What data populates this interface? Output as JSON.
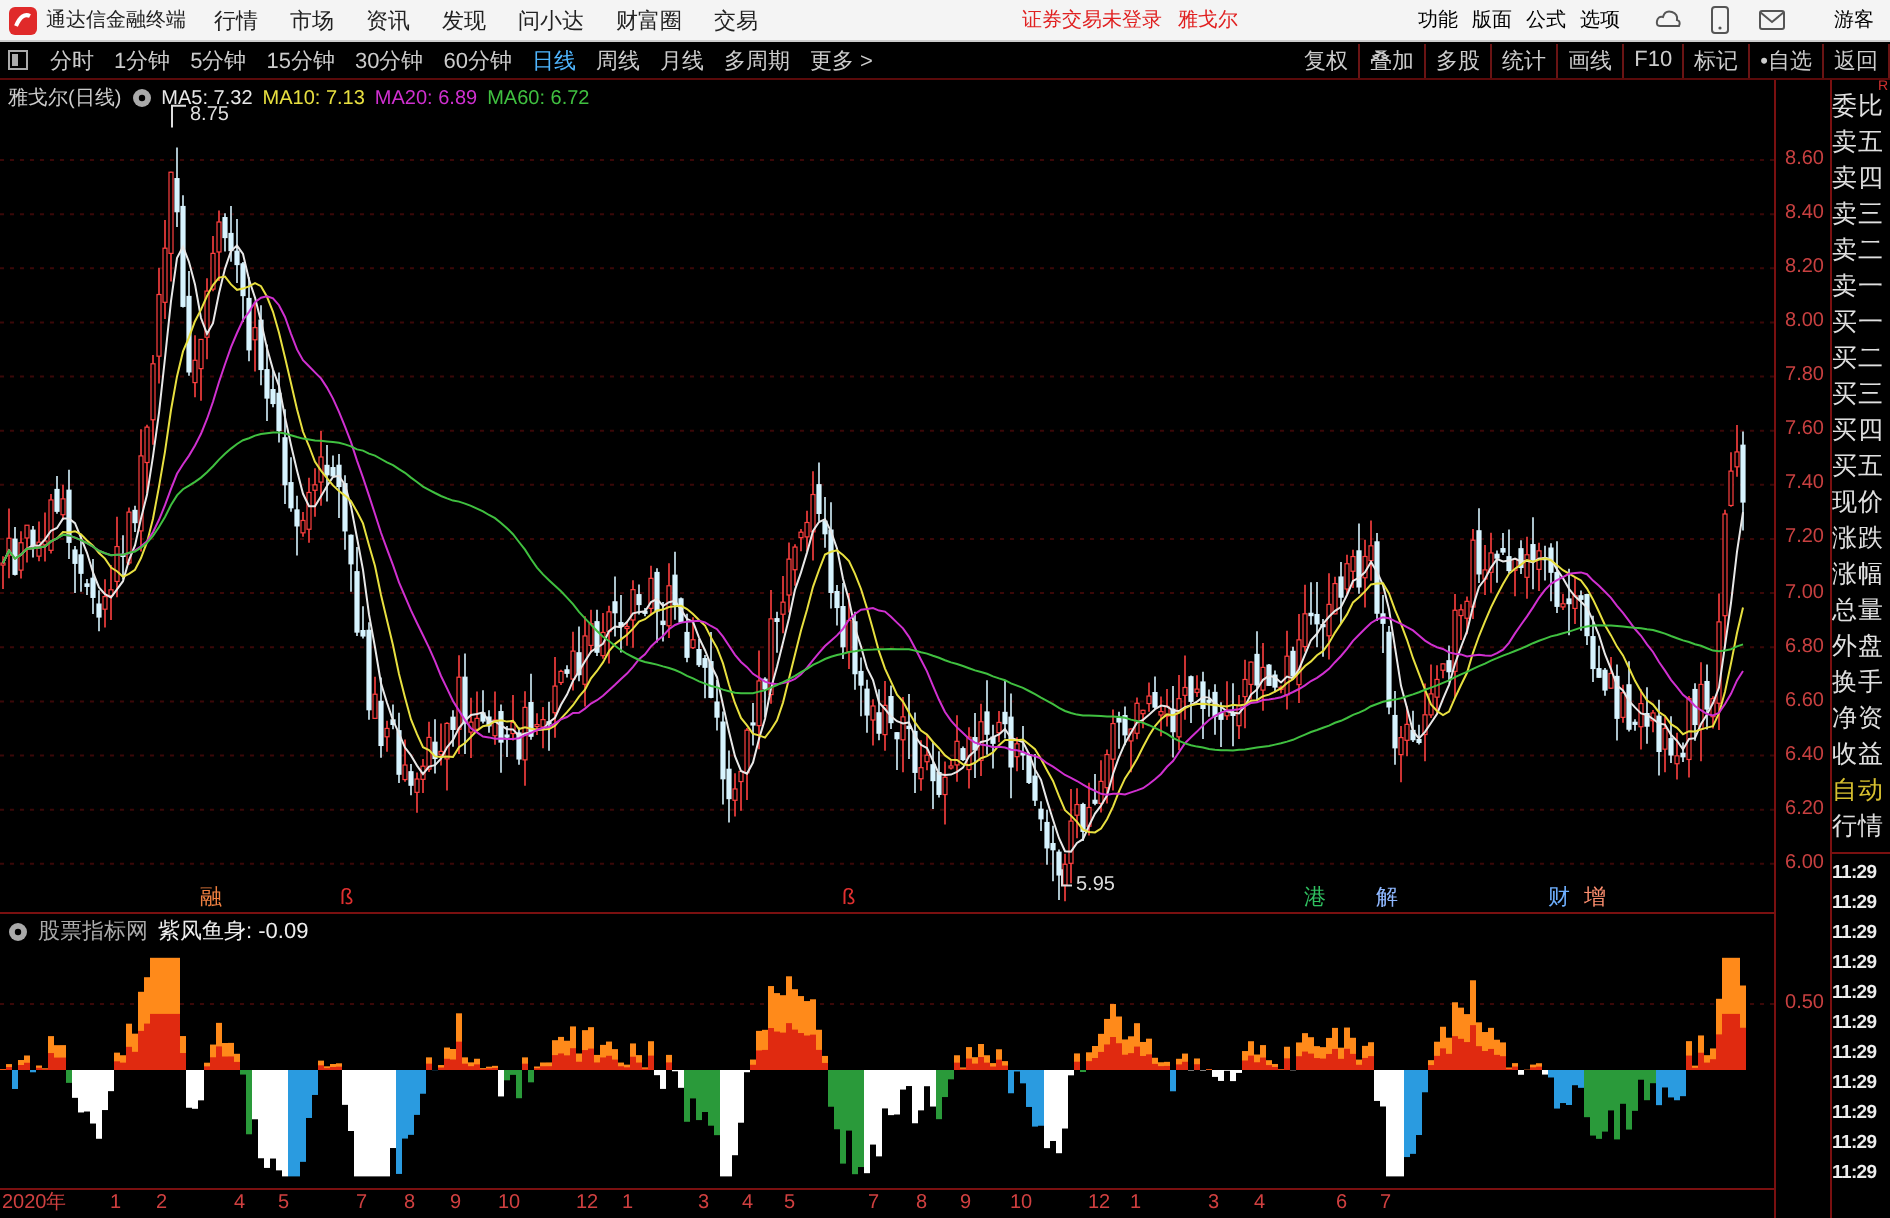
{
  "menu_bar": {
    "app_title": "通达信金融终端",
    "menus": [
      "行情",
      "市场",
      "资讯",
      "发现",
      "问小达",
      "财富圈",
      "交易"
    ],
    "login_status": "证券交易未登录",
    "stock_name": "雅戈尔",
    "right_menus": [
      "功能",
      "版面",
      "公式",
      "选项"
    ],
    "user": "游客"
  },
  "toolbar": {
    "periods": [
      {
        "label": "分时",
        "selected": false
      },
      {
        "label": "1分钟",
        "selected": false
      },
      {
        "label": "5分钟",
        "selected": false
      },
      {
        "label": "15分钟",
        "selected": false
      },
      {
        "label": "30分钟",
        "selected": false
      },
      {
        "label": "60分钟",
        "selected": false
      },
      {
        "label": "日线",
        "selected": true
      },
      {
        "label": "周线",
        "selected": false
      },
      {
        "label": "月线",
        "selected": false
      },
      {
        "label": "多周期",
        "selected": false
      }
    ],
    "more": "更多 >",
    "tools": [
      "复权",
      "叠加",
      "多股",
      "统计",
      "画线",
      "F10",
      "标记",
      "•自选",
      "返回"
    ]
  },
  "chart": {
    "title": "雅戈尔(日线)",
    "ma": [
      {
        "label": "MA5: 7.32",
        "color": "#e8e8e8"
      },
      {
        "label": "MA10: 7.13",
        "color": "#e8e040"
      },
      {
        "label": "MA20: 6.89",
        "color": "#d030d0"
      },
      {
        "label": "MA60: 6.72",
        "color": "#40c040"
      }
    ],
    "high_label": "8.75",
    "low_label": "5.95",
    "price_axis": [
      "8.60",
      "8.40",
      "8.20",
      "8.00",
      "7.80",
      "7.60",
      "7.40",
      "7.20",
      "7.00",
      "6.80",
      "6.60",
      "6.40",
      "6.20",
      "6.00"
    ],
    "events": [
      {
        "label": "融",
        "color": "#f08040"
      },
      {
        "label": "ß",
        "color": "#e03030"
      },
      {
        "label": "ß",
        "color": "#e03030"
      },
      {
        "label": "港",
        "color": "#30c060"
      },
      {
        "label": "解",
        "color": "#8fb8ff"
      },
      {
        "label": "财",
        "color": "#6fb0ff"
      },
      {
        "label": "增",
        "color": "#ff9070"
      }
    ],
    "indicator": {
      "source": "股票指标网",
      "title": "紫风鱼身: -0.09",
      "axis_label": "0.50"
    },
    "x_axis": [
      "2020年",
      "1",
      "2",
      "4",
      "5",
      "7",
      "8",
      "9",
      "10",
      "12",
      "1",
      "3",
      "4",
      "5",
      "7",
      "8",
      "9",
      "10",
      "12",
      "1",
      "3",
      "4",
      "6",
      "7"
    ]
  },
  "quote_panel": {
    "corner": "R",
    "fields": [
      {
        "label": "委比",
        "color": "#e0e0e0"
      },
      {
        "label": "卖五",
        "color": "#e0e0e0"
      },
      {
        "label": "卖四",
        "color": "#e0e0e0"
      },
      {
        "label": "卖三",
        "color": "#e0e0e0"
      },
      {
        "label": "卖二",
        "color": "#e0e0e0"
      },
      {
        "label": "卖一",
        "color": "#e0e0e0"
      },
      {
        "label": "买一",
        "color": "#e0e0e0"
      },
      {
        "label": "买二",
        "color": "#e0e0e0"
      },
      {
        "label": "买三",
        "color": "#e0e0e0"
      },
      {
        "label": "买四",
        "color": "#e0e0e0"
      },
      {
        "label": "买五",
        "color": "#e0e0e0"
      },
      {
        "label": "现价",
        "color": "#e0e0e0"
      },
      {
        "label": "涨跌",
        "color": "#e0e0e0"
      },
      {
        "label": "涨幅",
        "color": "#e0e0e0"
      },
      {
        "label": "总量",
        "color": "#e0e0e0"
      },
      {
        "label": "外盘",
        "color": "#e0e0e0"
      },
      {
        "label": "换手",
        "color": "#e0e0e0"
      },
      {
        "label": "净资",
        "color": "#e0e0e0"
      },
      {
        "label": "收益",
        "color": "#e0e0e0"
      },
      {
        "label": "自动",
        "color": "#d8c030"
      },
      {
        "label": "行情",
        "color": "#e0e0e0"
      }
    ],
    "times": [
      "11:29",
      "11:29",
      "11:29",
      "11:29",
      "11:29",
      "11:29",
      "11:29",
      "11:29",
      "11:29",
      "11:29",
      "11:29"
    ]
  }
}
